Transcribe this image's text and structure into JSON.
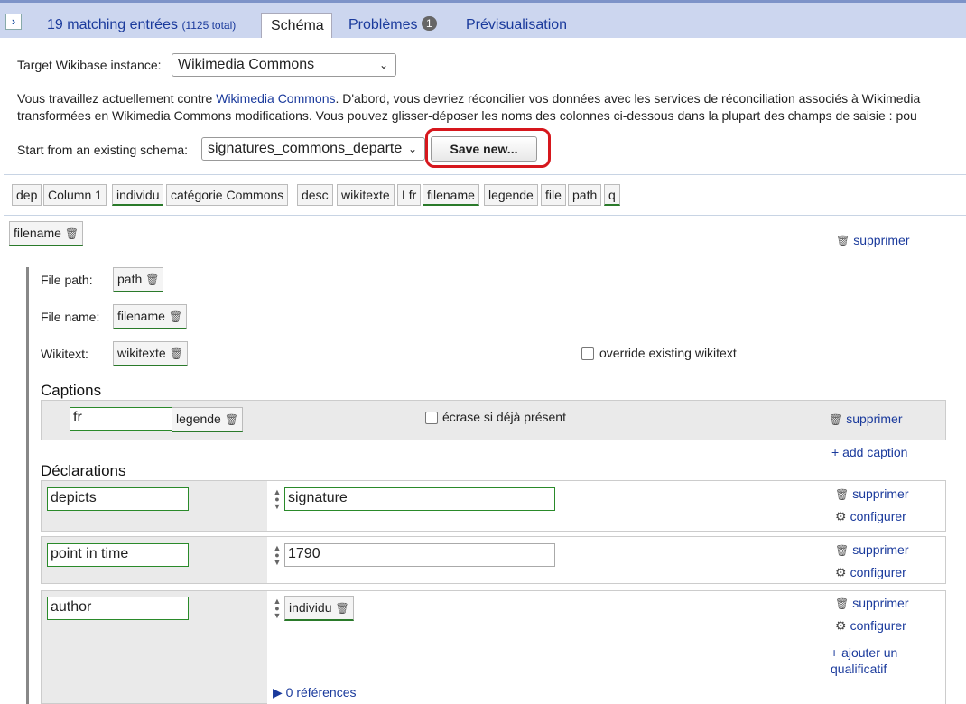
{
  "tabs": {
    "matching": "19 matching entrées",
    "total": "(1125 total)",
    "schema": "Schéma",
    "problems": "Problèmes",
    "problems_count": "1",
    "preview": "Prévisualisation"
  },
  "target": {
    "label": "Target Wikibase instance:",
    "value": "Wikimedia Commons"
  },
  "info": {
    "line1_pre": "Vous travaillez actuellement contre ",
    "line1_link": "Wikimedia Commons",
    "line1_post": ". D'abord, vous devriez réconcilier vos données avec les services de réconciliation associés à Wikimedia",
    "line2": "transformées en Wikimedia Commons modifications. Vous pouvez glisser-déposer les noms des colonnes ci-dessous dans la plupart des champs de saisie : pou"
  },
  "schema_select": {
    "label": "Start from an existing schema:",
    "value": "signatures_commons_departe",
    "save_button": "Save new..."
  },
  "columns": [
    "dep",
    "Column 1",
    "individu",
    "catégorie Commons",
    "desc",
    "wikitexte",
    "Lfr",
    "filename",
    "legende",
    "file",
    "path",
    "q"
  ],
  "subject": {
    "chip": "filename",
    "delete": "supprimer"
  },
  "file": {
    "path_label": "File path:",
    "path_chip": "path",
    "name_label": "File name:",
    "name_chip": "filename",
    "wikitext_label": "Wikitext:",
    "wikitext_chip": "wikitexte",
    "override_label": "override existing wikitext"
  },
  "captions": {
    "title": "Captions",
    "lang": "fr",
    "chip": "legende",
    "overwrite_label": "écrase si déjà présent",
    "delete": "supprimer",
    "add": "+ add caption"
  },
  "declarations": {
    "title": "Déclarations",
    "items": [
      {
        "property": "depicts",
        "value": "signature",
        "delete": "supprimer",
        "configure": "configurer"
      },
      {
        "property": "point in time",
        "value": "1790",
        "delete": "supprimer",
        "configure": "configurer"
      },
      {
        "property": "author",
        "value_chip": "individu",
        "delete": "supprimer",
        "configure": "configurer",
        "add_qualifier_1": "+ ajouter un",
        "add_qualifier_2": "qualificatif",
        "references": "▶ 0 références"
      }
    ]
  },
  "icons": {
    "expand": "chevron-right-icon",
    "trash": "trash-icon",
    "gear": "gear-icon",
    "dropdown": "chevron-down-icon",
    "rank": "rank-icon"
  },
  "colors": {
    "accent": "#1a3a9c",
    "valid": "#2a7a2a",
    "highlight": "#d6171d",
    "tabbar": "#ccd6ef"
  }
}
